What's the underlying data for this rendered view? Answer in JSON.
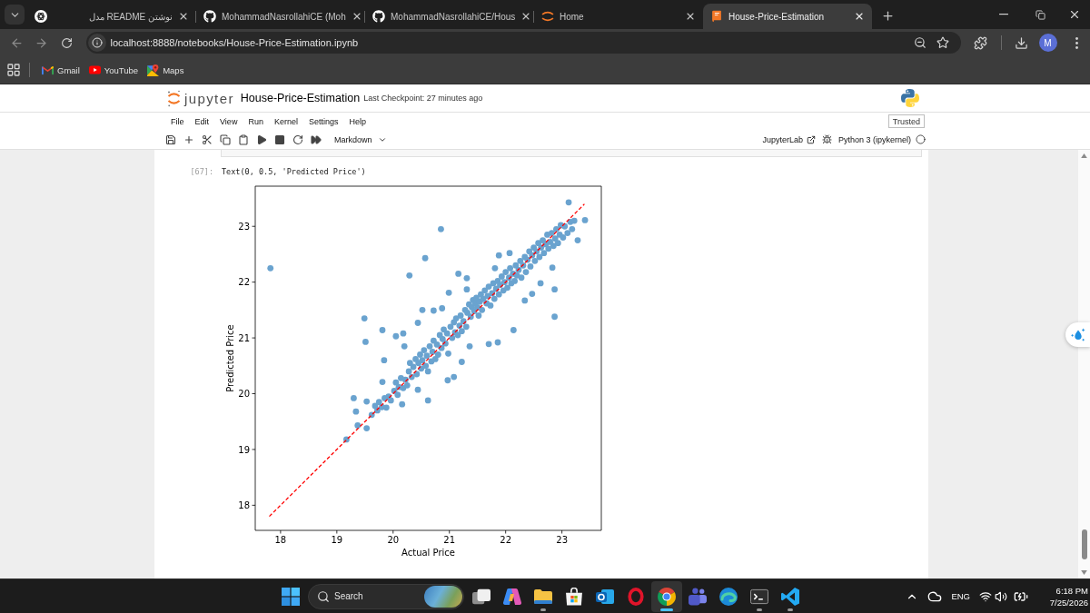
{
  "browser": {
    "tabs": [
      {
        "kind": "chatgpt",
        "title": "نوشتن README مدل",
        "selected": false
      },
      {
        "kind": "github",
        "title": "MohammadNasrollahiCE (Moh",
        "selected": false
      },
      {
        "kind": "github",
        "title": "MohammadNasrollahiCE/Hous",
        "selected": false
      },
      {
        "kind": "jupyter",
        "title": "Home",
        "selected": false
      },
      {
        "kind": "notebook",
        "title": "House-Price-Estimation",
        "selected": true
      }
    ],
    "back_enabled": false,
    "forward_enabled": false,
    "url": "localhost:8888/notebooks/House-Price-Estimation.ipynb",
    "profile_initial": "M",
    "bookmarks": [
      {
        "kind": "gmail",
        "label": "Gmail"
      },
      {
        "kind": "youtube",
        "label": "YouTube"
      },
      {
        "kind": "maps",
        "label": "Maps"
      }
    ]
  },
  "jupyter": {
    "logo_text": "jupyter",
    "notebook_name": "House-Price-Estimation",
    "checkpoint": "Last Checkpoint: 27 minutes ago",
    "menu": [
      "File",
      "Edit",
      "View",
      "Run",
      "Kernel",
      "Settings",
      "Help"
    ],
    "trusted_label": "Trusted",
    "cell_type": "Markdown",
    "jupyterlab_label": "JupyterLab",
    "kernel_name": "Python 3 (ipykernel)",
    "kernel_busy": false
  },
  "output": {
    "prompt": "[67]:",
    "text": "Text(0, 0.5, 'Predicted Price')",
    "chart_data": {
      "type": "scatter",
      "xlabel": "Actual Price",
      "ylabel": "Predicted Price",
      "xlim": [
        17.55,
        23.7
      ],
      "ylim": [
        17.55,
        23.72
      ],
      "xticks": [
        18,
        19,
        20,
        21,
        22,
        23
      ],
      "yticks": [
        18,
        19,
        20,
        21,
        22,
        23
      ],
      "x": [
        17.82,
        20.85,
        20.57,
        20.29,
        19.49,
        19.51,
        19.81,
        19.84,
        19.81,
        19.3,
        19.34,
        19.37,
        19.53,
        19.53,
        19.17,
        23.12,
        23.41,
        23.28,
        22.87,
        22.87,
        22.14,
        21.86,
        21.7,
        21.36,
        21.22,
        21.08,
        20.97,
        20.62,
        20.16,
        20.44,
        20.05,
        20.18,
        20.2,
        20.44,
        20.52,
        20.72,
        20.87,
        20.99,
        21.16,
        21.31,
        21.31,
        21.81,
        21.88,
        22.07,
        22.34,
        22.47,
        22.62,
        22.83,
        19.62,
        19.68,
        19.72,
        19.75,
        19.8,
        19.85,
        19.88,
        19.92,
        19.96,
        20.02,
        20.05,
        20.08,
        20.1,
        20.14,
        20.18,
        20.22,
        20.25,
        20.28,
        20.3,
        20.33,
        20.36,
        20.4,
        20.42,
        20.45,
        20.48,
        20.5,
        20.52,
        20.55,
        20.58,
        20.6,
        20.62,
        20.65,
        20.68,
        20.7,
        20.72,
        20.75,
        20.78,
        20.8,
        20.83,
        20.86,
        20.88,
        20.9,
        20.93,
        20.96,
        20.98,
        21.02,
        21.05,
        21.08,
        21.1,
        21.12,
        21.15,
        21.18,
        21.2,
        21.22,
        21.25,
        21.28,
        21.3,
        21.32,
        21.35,
        21.38,
        21.4,
        21.42,
        21.44,
        21.46,
        21.48,
        21.5,
        21.52,
        21.54,
        21.56,
        21.58,
        21.6,
        21.63,
        21.66,
        21.68,
        21.7,
        21.73,
        21.76,
        21.78,
        21.8,
        21.83,
        21.86,
        21.88,
        21.9,
        21.93,
        21.96,
        21.98,
        22.0,
        22.03,
        22.06,
        22.08,
        22.1,
        22.13,
        22.16,
        22.18,
        22.2,
        22.23,
        22.26,
        22.28,
        22.31,
        22.34,
        22.36,
        22.39,
        22.42,
        22.44,
        22.47,
        22.5,
        22.52,
        22.55,
        22.58,
        22.6,
        22.63,
        22.66,
        22.68,
        22.71,
        22.74,
        22.76,
        22.79,
        22.82,
        22.85,
        22.88,
        22.9,
        22.93,
        22.96,
        22.98,
        23.02,
        23.05,
        23.1,
        23.15,
        23.18,
        23.22
      ],
      "series": [
        {
          "color": "#6aa3cf",
          "values": [
            22.25,
            22.95,
            22.43,
            22.12,
            21.35,
            20.93,
            21.14,
            20.6,
            20.21,
            19.92,
            19.68,
            19.43,
            19.86,
            19.38,
            19.18,
            23.43,
            23.11,
            22.75,
            21.87,
            21.38,
            21.14,
            20.92,
            20.89,
            20.85,
            20.57,
            20.3,
            20.24,
            19.88,
            19.81,
            20.07,
            21.03,
            21.08,
            20.85,
            21.27,
            21.5,
            21.49,
            21.53,
            21.81,
            22.15,
            22.07,
            21.87,
            22.25,
            22.48,
            22.52,
            21.67,
            21.79,
            21.98,
            22.26,
            19.62,
            19.78,
            19.7,
            19.85,
            19.76,
            19.92,
            19.75,
            19.95,
            19.88,
            20.05,
            20.2,
            19.98,
            20.12,
            20.28,
            20.1,
            20.25,
            20.15,
            20.4,
            20.55,
            20.3,
            20.48,
            20.62,
            20.35,
            20.55,
            20.7,
            20.45,
            20.6,
            20.78,
            20.5,
            20.68,
            20.4,
            20.85,
            20.58,
            20.75,
            20.95,
            20.62,
            20.88,
            20.7,
            21.05,
            20.82,
            20.98,
            21.15,
            20.9,
            21.08,
            20.72,
            21.2,
            21.0,
            21.28,
            21.1,
            21.35,
            21.05,
            21.22,
            21.4,
            21.12,
            21.3,
            21.5,
            21.2,
            21.45,
            21.6,
            21.38,
            21.55,
            21.68,
            21.48,
            21.62,
            21.72,
            21.55,
            21.4,
            21.65,
            21.78,
            21.5,
            21.7,
            21.85,
            21.62,
            21.75,
            21.92,
            21.58,
            21.8,
            21.98,
            21.7,
            21.88,
            22.02,
            21.78,
            21.95,
            22.1,
            21.85,
            22.0,
            22.18,
            21.9,
            22.08,
            22.25,
            21.98,
            22.15,
            22.02,
            22.3,
            22.12,
            22.22,
            22.38,
            22.08,
            22.3,
            22.45,
            22.18,
            22.4,
            22.55,
            22.28,
            22.48,
            22.62,
            22.38,
            22.55,
            22.7,
            22.45,
            22.62,
            22.75,
            22.52,
            22.68,
            22.85,
            22.6,
            22.72,
            22.88,
            22.65,
            22.78,
            22.95,
            22.7,
            22.85,
            23.02,
            22.8,
            23.0,
            22.88,
            23.08,
            22.95,
            23.1
          ]
        },
        {
          "type": "line",
          "color": "#ff0000",
          "line_style": "dashed",
          "x": [
            17.8,
            23.4
          ],
          "values": [
            17.8,
            23.4
          ]
        }
      ]
    }
  },
  "taskbar": {
    "placeholder": "Search",
    "apps": [
      {
        "kind": "task-view",
        "running": false,
        "active": false
      },
      {
        "kind": "copilot",
        "running": false,
        "active": false
      },
      {
        "kind": "file-explorer",
        "running": true,
        "active": false
      },
      {
        "kind": "store",
        "running": false,
        "active": false
      },
      {
        "kind": "outlook",
        "running": false,
        "active": false
      },
      {
        "kind": "opera",
        "running": false,
        "active": false
      },
      {
        "kind": "chrome",
        "running": true,
        "active": true
      },
      {
        "kind": "teams",
        "running": false,
        "active": false
      },
      {
        "kind": "edge",
        "running": false,
        "active": false
      },
      {
        "kind": "terminal",
        "running": true,
        "active": false
      },
      {
        "kind": "vscode",
        "running": true,
        "active": false
      }
    ],
    "language": "ENG",
    "time": "6:18 PM",
    "date": "7/25/2026"
  }
}
